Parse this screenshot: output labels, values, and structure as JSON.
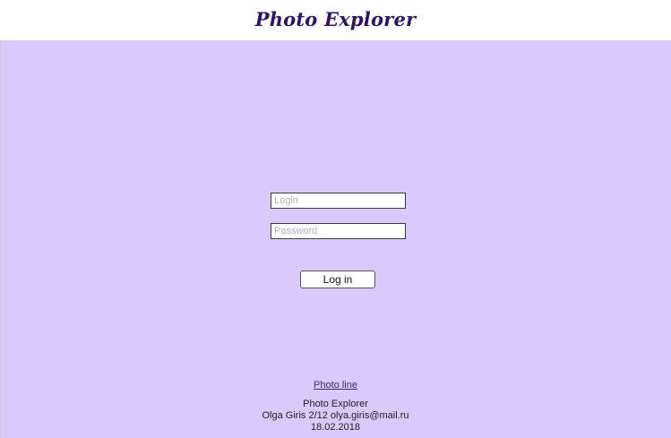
{
  "header": {
    "title": "Photo Explorer"
  },
  "login_form": {
    "login_placeholder": "Login",
    "password_placeholder": "Password",
    "submit_label": "Log in"
  },
  "footer": {
    "link_label": "Photo line",
    "app_name": "Photo Explorer",
    "author_line": "Olga Giris 2/12 olya.giris@mail.ru",
    "date": "18.02.2018"
  },
  "colors": {
    "background": "#d9c9fc",
    "title": "#2e1466",
    "link": "#3b2a80"
  }
}
